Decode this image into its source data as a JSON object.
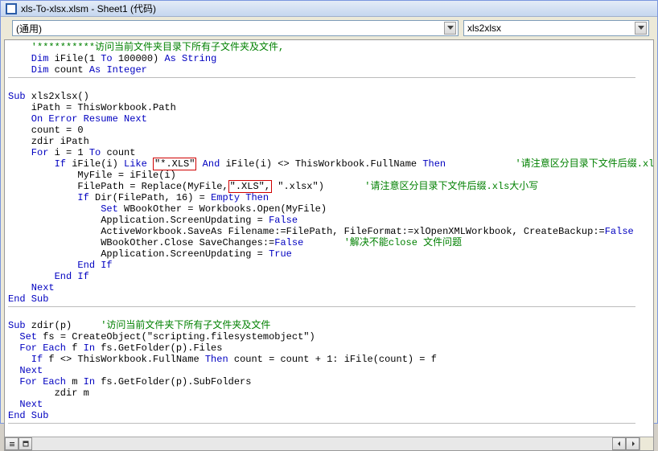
{
  "window": {
    "title": "xls-To-xlsx.xlsm - Sheet1 (代码)"
  },
  "dropdowns": {
    "object": "(通用)",
    "procedure": "xls2xlsx"
  },
  "code": {
    "l01a": "    '**********",
    "l01b": "访问当前文件夹目录下所有子文件夹及文件,",
    "l02a": "    Dim",
    "l02b": " iFile(1 ",
    "l02c": "To",
    "l02d": " 100000) ",
    "l02e": "As String",
    "l03a": "    Dim",
    "l03b": " count ",
    "l03c": "As Integer",
    "l05a": "Sub",
    "l05b": " xls2xlsx()",
    "l06": "    iPath = ThisWorkbook.Path",
    "l07a": "    On Error Resume Next",
    "l08": "    count = 0",
    "l09": "    zdir iPath",
    "l10a": "    For",
    "l10b": " i = 1 ",
    "l10c": "To",
    "l10d": " count",
    "l11a": "        If",
    "l11b": " iFile(i) ",
    "l11c": "Like",
    "l11d": " ",
    "l11box": "\"*.XLS\"",
    "l11e": " ",
    "l11f": "And",
    "l11g": " iFile(i) <> ThisWorkbook.FullName ",
    "l11h": "Then",
    "l11cmt": "            '请注意区分目录下文件后缀.xls大小写",
    "l12": "            MyFile = iFile(i)",
    "l13a": "            FilePath = Replace(MyFile,",
    "l13box": "\".XLS\",",
    "l13b": " \".xlsx\")",
    "l13cmt": "       '请注意区分目录下文件后缀.xls大小写",
    "l14a": "            If",
    "l14b": " Dir(FilePath, 16) = ",
    "l14c": "Empty Then",
    "l15a": "                Set ",
    "l15b": "WBookOther = Workbooks.Open(MyFile)",
    "l16a": "                Application.ScreenUpdating = ",
    "l16b": "False",
    "l17a": "                ActiveWorkbook.SaveAs Filename:=FilePath, FileFormat:=xlOpenXMLWorkbook, CreateBackup:=",
    "l17b": "False",
    "l18a": "                WBookOther.Close SaveChanges:=",
    "l18b": "False",
    "l18cmt": "       '解决不能close 文件问题",
    "l19a": "                Application.ScreenUpdating = ",
    "l19b": "True",
    "l20": "            End If",
    "l21": "        End If",
    "l22": "    Next",
    "l23": "End Sub",
    "l25a": "Sub",
    "l25b": " zdir(p)",
    "l25cmt": "     '访问当前文件夹下所有子文件夹及文件",
    "l26a": "  Set",
    "l26b": " fs = CreateObject(\"scripting.filesystemobject\")",
    "l27a": "  For Each",
    "l27b": " f ",
    "l27c": "In",
    "l27d": " fs.GetFolder(p).Files",
    "l28a": "    If",
    "l28b": " f <> ThisWorkbook.FullName ",
    "l28c": "Then",
    "l28d": " count = count + 1: iFile(count) = f",
    "l29": "  Next",
    "l30a": "  For Each",
    "l30b": " m ",
    "l30c": "In",
    "l30d": " fs.GetFolder(p).SubFolders",
    "l31": "        zdir m",
    "l32": "  Next",
    "l33": "End Sub"
  }
}
